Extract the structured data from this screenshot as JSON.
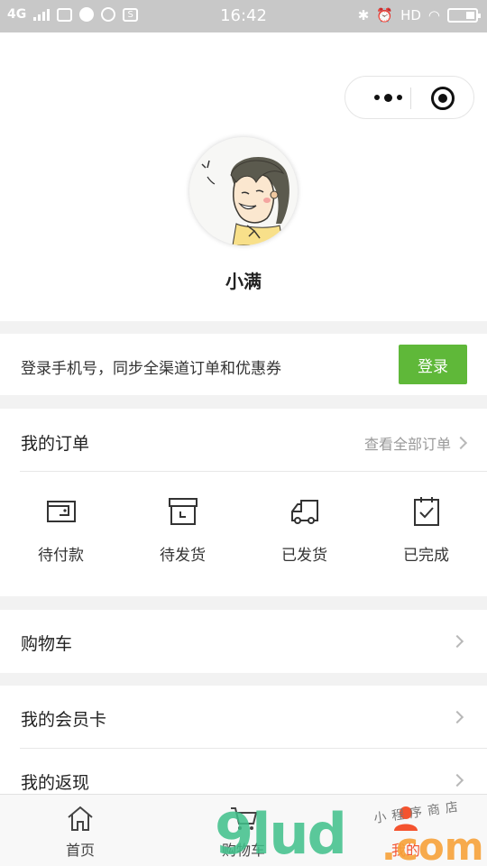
{
  "status_bar": {
    "network": "4G",
    "time": "16:42",
    "hd": "HD"
  },
  "capsule": {
    "more_icon": "more-dots-icon",
    "close_icon": "close-circle-icon"
  },
  "profile": {
    "username": "小满"
  },
  "login_bar": {
    "prompt": "登录手机号，同步全渠道订单和优惠券",
    "button": "登录"
  },
  "orders": {
    "title": "我的订单",
    "view_all": "查看全部订单",
    "items": [
      {
        "label": "待付款",
        "icon": "wallet-icon"
      },
      {
        "label": "待发货",
        "icon": "box-icon"
      },
      {
        "label": "已发货",
        "icon": "truck-icon"
      },
      {
        "label": "已完成",
        "icon": "clipboard-check-icon"
      }
    ]
  },
  "menu": [
    {
      "label": "购物车"
    },
    {
      "label": "我的会员卡"
    },
    {
      "label": "我的返现"
    }
  ],
  "tabbar": {
    "tabs": [
      {
        "label": "首页",
        "icon": "home-icon"
      },
      {
        "label": "购物车",
        "icon": "cart-icon"
      },
      {
        "label": "我的",
        "icon": "user-icon"
      }
    ],
    "active_color": "#f4532f"
  },
  "watermark": {
    "brand": "9lud",
    "domain": ".com",
    "handwriting": "小程序商店"
  },
  "colors": {
    "accent_green": "#5fb839",
    "divider": "#e8e8e8"
  }
}
